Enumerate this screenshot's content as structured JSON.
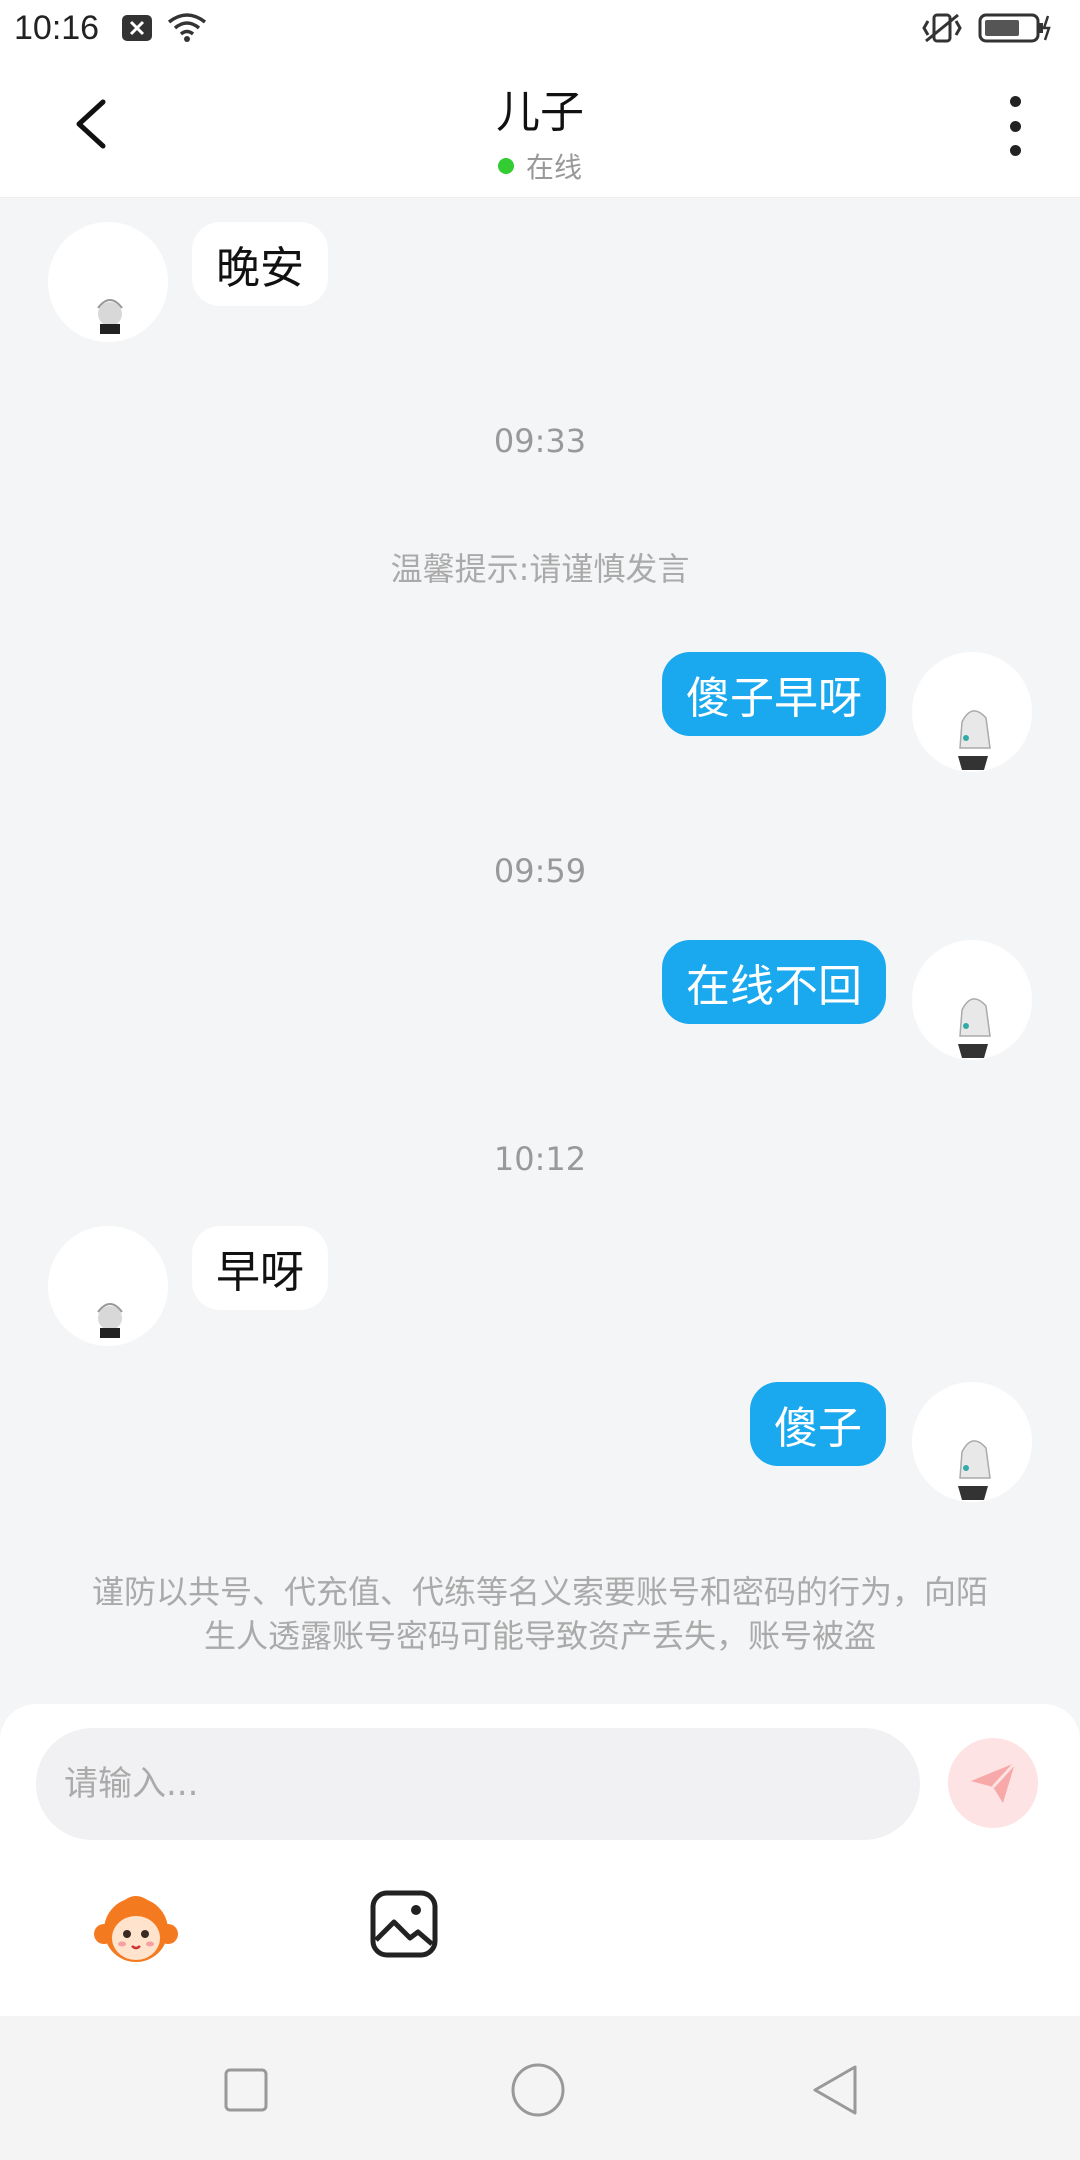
{
  "status_bar": {
    "time": "10:16",
    "icons": [
      "notification-x-icon",
      "wifi-icon",
      "vibrate-icon",
      "battery-icon"
    ]
  },
  "header": {
    "title": "儿子",
    "status": "在线",
    "status_color": "#33cc33",
    "back_icon": "chevron-left-icon",
    "more_icon": "more-vertical-icon"
  },
  "messages": [
    {
      "type": "incoming",
      "text": "晚安"
    },
    {
      "type": "timestamp",
      "text": "09:33"
    },
    {
      "type": "notice",
      "text": "温馨提示:请谨慎发言"
    },
    {
      "type": "outgoing",
      "text": "傻子早呀"
    },
    {
      "type": "timestamp",
      "text": "09:59"
    },
    {
      "type": "outgoing",
      "text": "在线不回"
    },
    {
      "type": "timestamp",
      "text": "10:12"
    },
    {
      "type": "incoming",
      "text": "早呀"
    },
    {
      "type": "outgoing",
      "text": "傻子"
    }
  ],
  "warning": "谨防以共号、代充值、代练等名义索要账号和密码的行为，向陌生人透露账号密码可能导致资产丢失，账号被盗",
  "input": {
    "placeholder": "请输入...",
    "send_icon": "send-icon",
    "emoji_icon": "monkey-emoji-icon",
    "image_icon": "image-icon"
  },
  "colors": {
    "outgoing_bubble": "#1aa8ef",
    "incoming_bubble": "#ffffff",
    "send_button": "#fde3e3"
  },
  "nav": {
    "icons": [
      "square-icon",
      "circle-icon",
      "triangle-back-icon"
    ]
  }
}
